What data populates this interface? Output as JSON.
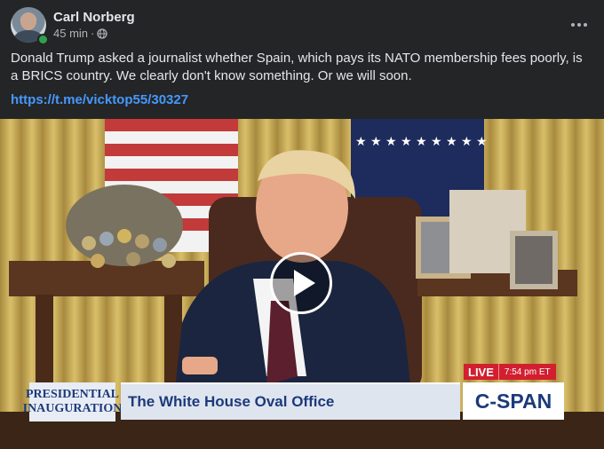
{
  "post": {
    "author": "Carl Norberg",
    "time": "45 min",
    "separator": "·",
    "privacy_icon": "globe-icon",
    "text": "Donald Trump asked a journalist whether Spain, which pays its NATO membership fees poorly, is a BRICS country. We clearly don't know something. Or we will soon.",
    "link": "https://t.me/vicktop55/30327",
    "more_icon": "more-horizontal-icon"
  },
  "video": {
    "play_icon": "play-icon",
    "chyron": {
      "logo_line1": "PRESIDENTIAL",
      "logo_line2": "INAUGURATION",
      "title": "The White House Oval Office",
      "live_label": "LIVE",
      "live_time": "7:54 pm ET",
      "network": "C-SPAN"
    }
  },
  "colors": {
    "background": "#242526",
    "text": "#e4e6eb",
    "meta": "#b0b3b8",
    "link": "#4599ff",
    "online": "#31a24c",
    "live_red": "#d21f2f",
    "chyron_blue": "#1c3a7a"
  }
}
